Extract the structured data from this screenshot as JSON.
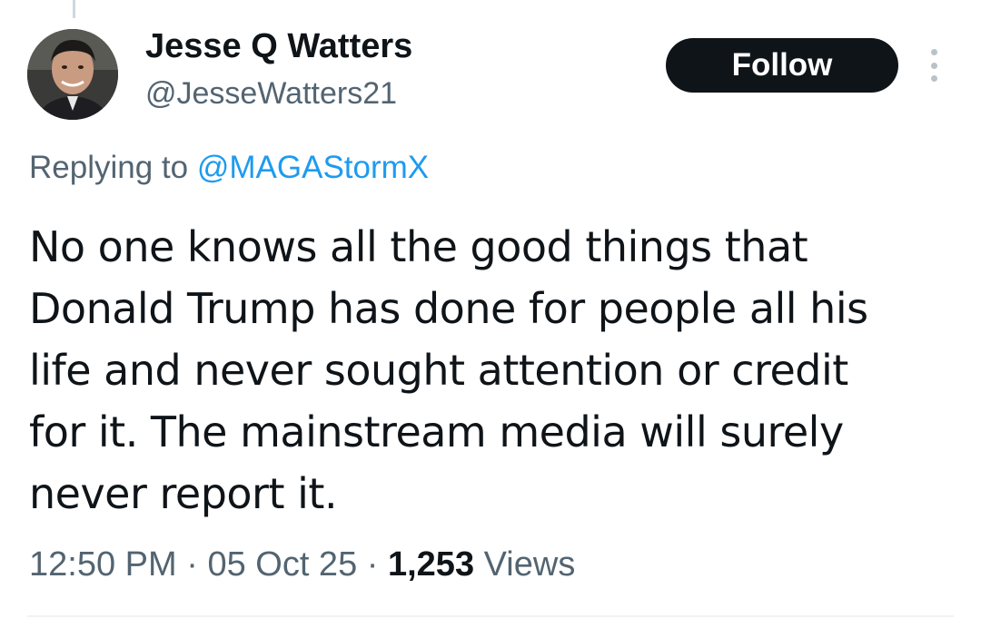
{
  "author": {
    "name": "Jesse Q Watters",
    "handle": "@JesseWatters21"
  },
  "follow_button": {
    "label": "Follow"
  },
  "more_menu": {
    "icon": "more-vertical-icon"
  },
  "reply": {
    "prefix": "Replying to",
    "mention": "@MAGAStormX"
  },
  "tweet": {
    "lines": [
      "No one knows all the good things that",
      "Donald Trump has done for people all his",
      "life and never sought attention or credit",
      "for it. The mainstream media will surely",
      "never report it."
    ]
  },
  "meta": {
    "time": "12:50 PM",
    "separator": "·",
    "date": "05 Oct 25",
    "views_count": "1,253",
    "views_label": "Views"
  },
  "colors": {
    "text": "#0f1419",
    "secondary": "#536471",
    "link": "#1d9bf0",
    "button_bg": "#0f1419"
  }
}
